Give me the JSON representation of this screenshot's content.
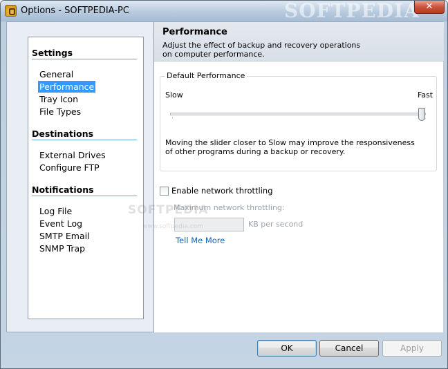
{
  "window": {
    "title": "Options - SOFTPEDIA-PC",
    "watermark": "SOFTPEDIA",
    "close_label": "✕"
  },
  "sidebar": {
    "sections": [
      {
        "heading": "Settings",
        "items": [
          "General",
          "Performance",
          "Tray Icon",
          "File Types"
        ]
      },
      {
        "heading": "Destinations",
        "items": [
          "External Drives",
          "Configure FTP"
        ]
      },
      {
        "heading": "Notifications",
        "items": [
          "Log File",
          "Event Log",
          "SMTP Email",
          "SNMP Trap"
        ]
      }
    ],
    "selected": "Performance"
  },
  "panel": {
    "title": "Performance",
    "description": "Adjust the effect of backup and recovery operations on computer performance.",
    "group": {
      "legend": "Default Performance",
      "slow_label": "Slow",
      "fast_label": "Fast",
      "slider_value_fraction": 1.0,
      "description": "Moving the slider closer to Slow may improve the responsiveness of other programs during a backup or recovery."
    },
    "throttle": {
      "checkbox_label": "Enable network throttling",
      "checked": false,
      "max_label": "Maximum network throttling:",
      "input_value": "",
      "unit_label": "KB per second",
      "link_label": "Tell Me More"
    }
  },
  "overlay_watermark": {
    "text": "SOFTPEDIA",
    "url": "www.softpedia.com"
  },
  "buttons": {
    "ok": "OK",
    "cancel": "Cancel",
    "apply": "Apply"
  }
}
